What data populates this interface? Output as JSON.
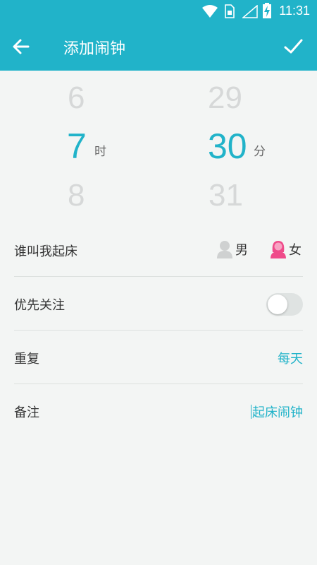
{
  "status_bar": {
    "time": "11:31"
  },
  "header": {
    "title": "添加闹钟"
  },
  "picker": {
    "hour": {
      "prev": "6",
      "selected": "7",
      "next": "8",
      "unit": "时"
    },
    "minute": {
      "prev": "29",
      "selected": "30",
      "next": "31",
      "unit": "分"
    }
  },
  "settings": {
    "wake_voice": {
      "label": "谁叫我起床",
      "options": [
        "男",
        "女"
      ],
      "selected": "女"
    },
    "priority": {
      "label": "优先关注",
      "enabled": false
    },
    "repeat": {
      "label": "重复",
      "value": "每天"
    },
    "note": {
      "label": "备注",
      "value": "起床闹钟"
    }
  },
  "colors": {
    "accent": "#21b3c9",
    "female_icon": "#ef4b8a",
    "male_icon": "#cfd1d1"
  },
  "icons": [
    "wifi-icon",
    "sim-icon",
    "signal-icon",
    "battery-icon",
    "back-arrow-icon",
    "checkmark-icon",
    "male-voice-icon",
    "female-voice-icon"
  ]
}
